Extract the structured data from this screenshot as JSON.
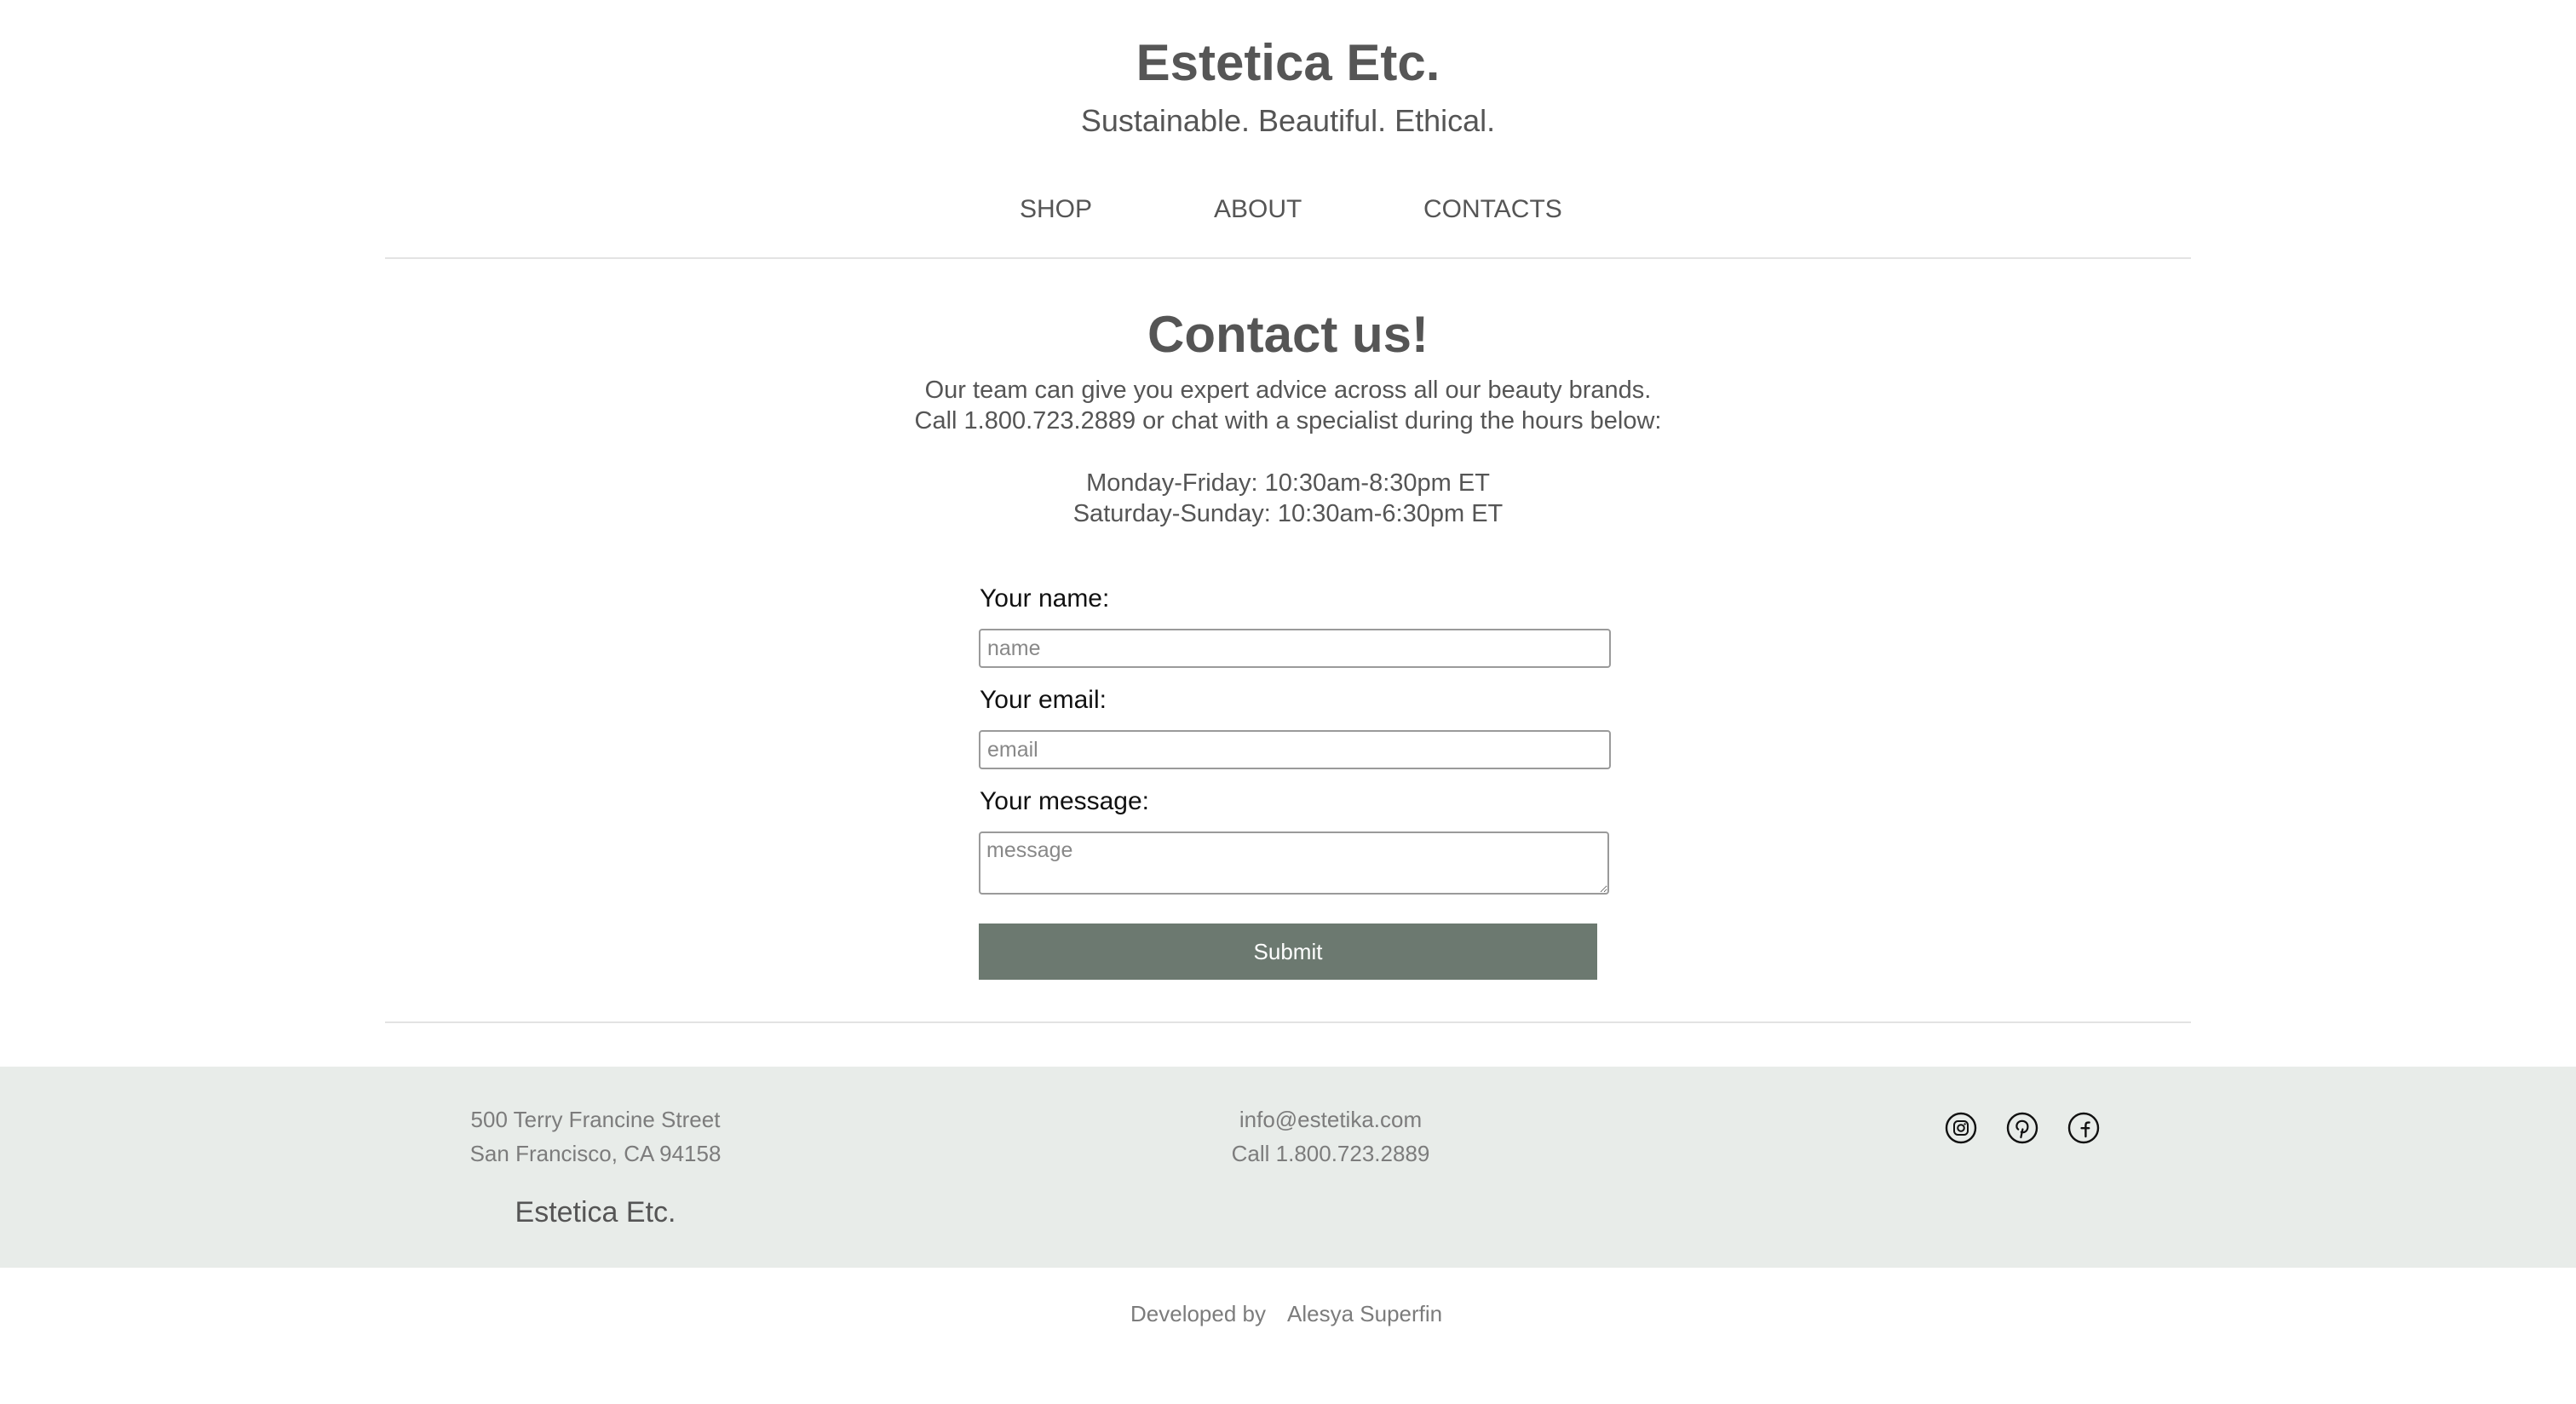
{
  "header": {
    "site_title": "Estetica Etc.",
    "tagline": "Sustainable. Beautiful. Ethical."
  },
  "nav": {
    "items": [
      {
        "label": "SHOP"
      },
      {
        "label": "ABOUT"
      },
      {
        "label": "CONTACTS"
      }
    ]
  },
  "contact": {
    "heading": "Contact us!",
    "intro_line_1": "Our team can give you expert advice across all our beauty brands.",
    "intro_line_2": "Call 1.800.723.2889 or chat with a specialist during the hours below:",
    "hours_weekdays": "Monday-Friday: 10:30am-8:30pm ET",
    "hours_weekend": "Saturday-Sunday: 10:30am-6:30pm ET"
  },
  "form": {
    "name_label": "Your name:",
    "name_placeholder": "name",
    "email_label": "Your email:",
    "email_placeholder": "email",
    "message_label": "Your message:",
    "message_placeholder": "message",
    "submit_label": "Submit"
  },
  "footer": {
    "address_line_1": "500 Terry Francine Street",
    "address_line_2": "San Francisco, CA 94158",
    "brand": "Estetica Etc.",
    "email": "info@estetika.com",
    "phone": "Call 1.800.723.2889",
    "social_icons": [
      "instagram-icon",
      "pinterest-icon",
      "facebook-icon"
    ]
  },
  "credit": {
    "prefix": "Developed by",
    "author": "Alesya Superfin"
  },
  "colors": {
    "accent": "#6c7970",
    "footer_bg": "#e8ece9",
    "text": "#555555"
  }
}
